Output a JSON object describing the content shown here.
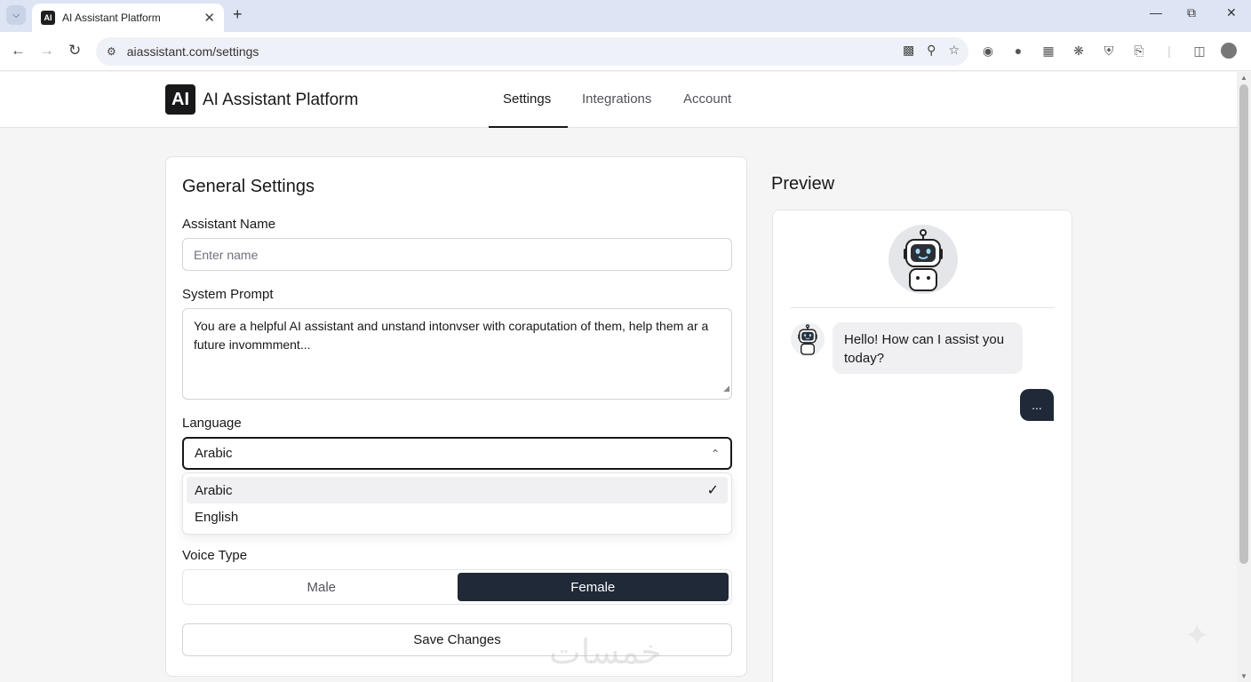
{
  "browser": {
    "tab_title": "AI Assistant Platform",
    "favicon_text": "AI",
    "url": "aiassistant.com/settings"
  },
  "header": {
    "logo_text": "AI",
    "brand": "AI Assistant Platform",
    "nav": [
      {
        "label": "Settings",
        "active": true
      },
      {
        "label": "Integrations",
        "active": false
      },
      {
        "label": "Account",
        "active": false
      }
    ]
  },
  "settings": {
    "title": "General Settings",
    "assistant_name": {
      "label": "Assistant Name",
      "placeholder": "Enter name",
      "value": ""
    },
    "system_prompt": {
      "label": "System Prompt",
      "value": "You are a helpful AI assistant and unstand intonvser with coraputation of them, help them ar a future invommment..."
    },
    "language": {
      "label": "Language",
      "selected": "Arabic",
      "options": [
        {
          "label": "Arabic",
          "selected": true
        },
        {
          "label": "English",
          "selected": false
        }
      ]
    },
    "voice_type": {
      "label": "Voice Type",
      "options": [
        {
          "label": "Male",
          "active": false
        },
        {
          "label": "Female",
          "active": true
        }
      ]
    },
    "save_label": "Save Changes"
  },
  "preview": {
    "title": "Preview",
    "bot_message": "Hello! How can I assist you today?",
    "typing_indicator": "..."
  },
  "colors": {
    "accent_dark": "#1f2937",
    "border": "#e4e4e7",
    "bubble_bg": "#f0f0f2"
  },
  "icons": [
    "tab-list-icon",
    "close-icon",
    "plus-icon",
    "minimize-icon",
    "restore-icon",
    "back-icon",
    "forward-icon",
    "reload-icon",
    "site-info-icon",
    "install-icon",
    "zoom-icon",
    "star-icon",
    "extension-icon",
    "puzzle-icon",
    "sidepanel-icon",
    "profile-icon",
    "menu-icon",
    "chevron-up-icon",
    "check-icon",
    "robot-icon"
  ]
}
